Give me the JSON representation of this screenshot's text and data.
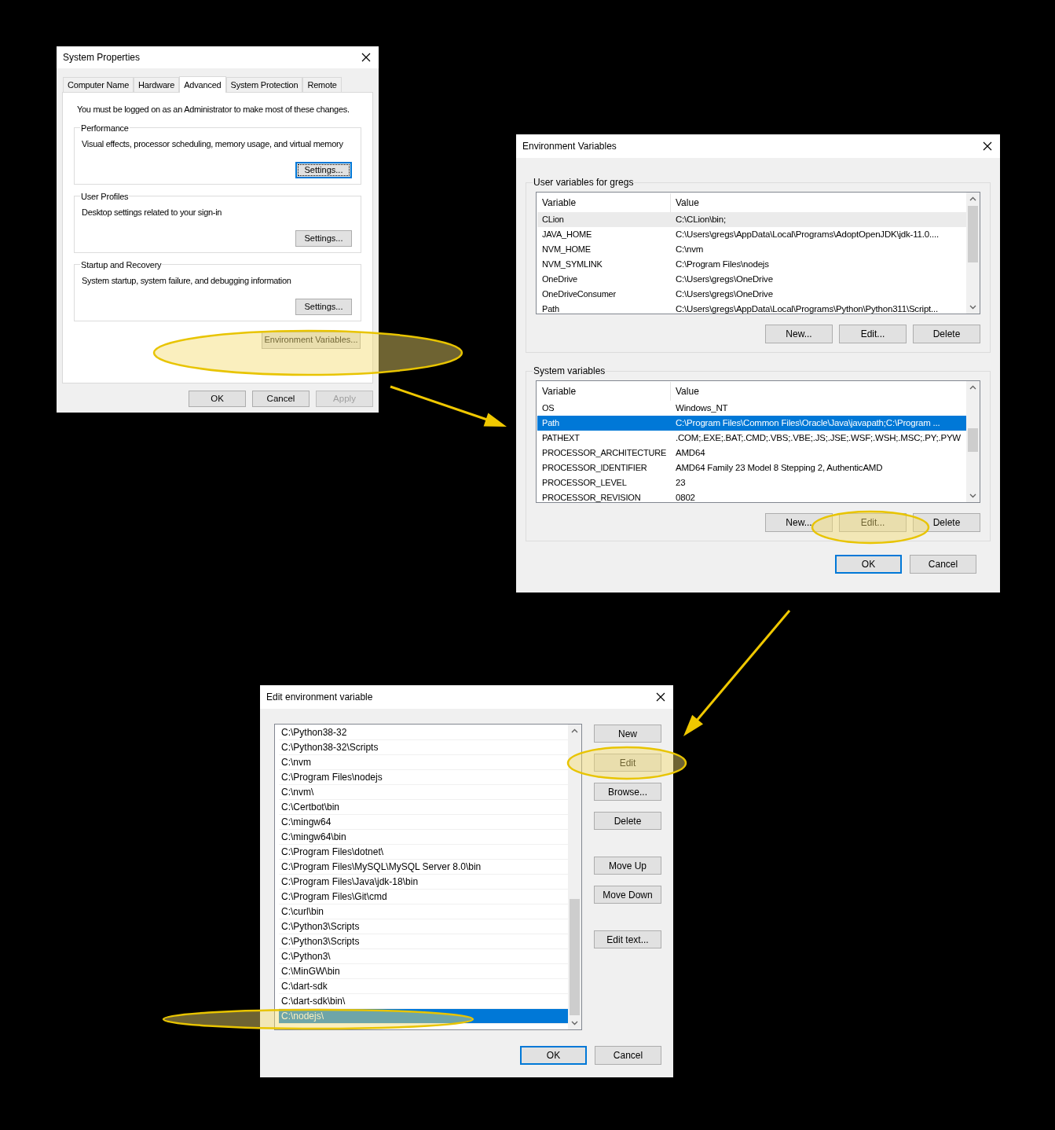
{
  "system_properties": {
    "title": "System Properties",
    "tabs": [
      {
        "label": "Computer Name",
        "selected": false
      },
      {
        "label": "Hardware",
        "selected": false
      },
      {
        "label": "Advanced",
        "selected": true
      },
      {
        "label": "System Protection",
        "selected": false
      },
      {
        "label": "Remote",
        "selected": false
      }
    ],
    "notice": "You must be logged on as an Administrator to make most of these changes.",
    "groups": [
      {
        "title": "Performance",
        "description": "Visual effects, processor scheduling, memory usage, and virtual memory",
        "button": {
          "label": "Settings...",
          "focused": true
        }
      },
      {
        "title": "User Profiles",
        "description": "Desktop settings related to your sign-in",
        "button": {
          "label": "Settings...",
          "focused": false
        }
      },
      {
        "title": "Startup and Recovery",
        "description": "System startup, system failure, and debugging information",
        "button": {
          "label": "Settings...",
          "focused": false
        }
      }
    ],
    "env_button": "Environment Variables...",
    "buttons": [
      {
        "label": "OK",
        "disabled": false
      },
      {
        "label": "Cancel",
        "disabled": false
      },
      {
        "label": "Apply",
        "disabled": true
      }
    ]
  },
  "environment_variables": {
    "title": "Environment Variables",
    "sections": [
      {
        "title": "User variables for gregs",
        "columns": [
          "Variable",
          "Value"
        ],
        "rows": [
          {
            "variable": "CLion",
            "value": "C:\\CLion\\bin;",
            "selected": false,
            "hovered": true
          },
          {
            "variable": "JAVA_HOME",
            "value": "C:\\Users\\gregs\\AppData\\Local\\Programs\\AdoptOpenJDK\\jdk-11.0....",
            "selected": false,
            "hovered": false
          },
          {
            "variable": "NVM_HOME",
            "value": "C:\\nvm",
            "selected": false,
            "hovered": false
          },
          {
            "variable": "NVM_SYMLINK",
            "value": "C:\\Program Files\\nodejs",
            "selected": false,
            "hovered": false
          },
          {
            "variable": "OneDrive",
            "value": "C:\\Users\\gregs\\OneDrive",
            "selected": false,
            "hovered": false
          },
          {
            "variable": "OneDriveConsumer",
            "value": "C:\\Users\\gregs\\OneDrive",
            "selected": false,
            "hovered": false
          },
          {
            "variable": "Path",
            "value": "C:\\Users\\gregs\\AppData\\Local\\Programs\\Python\\Python311\\Script...",
            "selected": false,
            "hovered": false
          }
        ],
        "buttons": [
          "New...",
          "Edit...",
          "Delete"
        ]
      },
      {
        "title": "System variables",
        "columns": [
          "Variable",
          "Value"
        ],
        "rows": [
          {
            "variable": "OS",
            "value": "Windows_NT",
            "selected": false,
            "hovered": false
          },
          {
            "variable": "Path",
            "value": "C:\\Program Files\\Common Files\\Oracle\\Java\\javapath;C:\\Program ...",
            "selected": true,
            "hovered": false
          },
          {
            "variable": "PATHEXT",
            "value": ".COM;.EXE;.BAT;.CMD;.VBS;.VBE;.JS;.JSE;.WSF;.WSH;.MSC;.PY;.PYW",
            "selected": false,
            "hovered": false
          },
          {
            "variable": "PROCESSOR_ARCHITECTURE",
            "value": "AMD64",
            "selected": false,
            "hovered": false
          },
          {
            "variable": "PROCESSOR_IDENTIFIER",
            "value": "AMD64 Family 23 Model 8 Stepping 2, AuthenticAMD",
            "selected": false,
            "hovered": false
          },
          {
            "variable": "PROCESSOR_LEVEL",
            "value": "23",
            "selected": false,
            "hovered": false
          },
          {
            "variable": "PROCESSOR_REVISION",
            "value": "0802",
            "selected": false,
            "hovered": false
          }
        ],
        "buttons": [
          "New...",
          "Edit...",
          "Delete"
        ]
      }
    ],
    "buttons": [
      {
        "label": "OK",
        "default": true
      },
      {
        "label": "Cancel",
        "default": false
      }
    ]
  },
  "edit_variable": {
    "title": "Edit environment variable",
    "entries": [
      {
        "text": "C:\\Python38-32",
        "selected": false
      },
      {
        "text": "C:\\Python38-32\\Scripts",
        "selected": false
      },
      {
        "text": "C:\\nvm",
        "selected": false
      },
      {
        "text": "C:\\Program Files\\nodejs",
        "selected": false
      },
      {
        "text": "C:\\nvm\\",
        "selected": false
      },
      {
        "text": "C:\\Certbot\\bin",
        "selected": false
      },
      {
        "text": "C:\\mingw64",
        "selected": false
      },
      {
        "text": "C:\\mingw64\\bin",
        "selected": false
      },
      {
        "text": "C:\\Program Files\\dotnet\\",
        "selected": false
      },
      {
        "text": "C:\\Program Files\\MySQL\\MySQL Server 8.0\\bin",
        "selected": false
      },
      {
        "text": "C:\\Program Files\\Java\\jdk-18\\bin",
        "selected": false
      },
      {
        "text": "C:\\Program Files\\Git\\cmd",
        "selected": false
      },
      {
        "text": "C:\\curl\\bin",
        "selected": false
      },
      {
        "text": "C:\\Python3\\Scripts",
        "selected": false
      },
      {
        "text": "C:\\Python3\\Scripts",
        "selected": false
      },
      {
        "text": "C:\\Python3\\",
        "selected": false
      },
      {
        "text": "C:\\MinGW\\bin",
        "selected": false
      },
      {
        "text": "C:\\dart-sdk",
        "selected": false
      },
      {
        "text": "C:\\dart-sdk\\bin\\",
        "selected": false
      },
      {
        "text": "C:\\nodejs\\",
        "selected": true
      }
    ],
    "button_groups": [
      [
        "New",
        "Edit",
        "Browse...",
        "Delete"
      ],
      [
        "Move Up",
        "Move Down"
      ],
      [
        "Edit text..."
      ]
    ],
    "buttons": [
      {
        "label": "OK",
        "default": true
      },
      {
        "label": "Cancel",
        "default": false
      }
    ]
  }
}
